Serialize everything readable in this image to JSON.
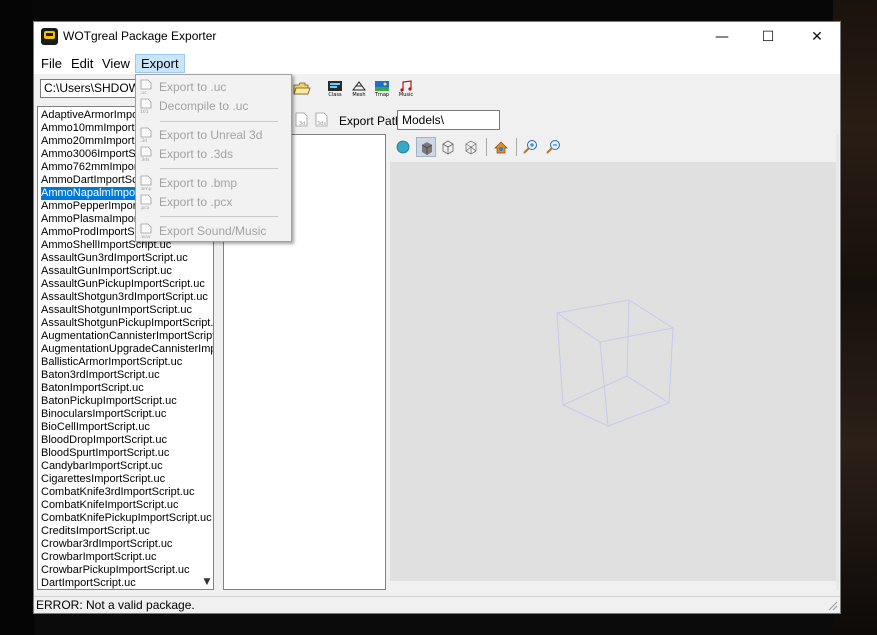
{
  "window": {
    "title": "WOTgreal Package Exporter",
    "controls": {
      "minimize": "—",
      "maximize": "☐",
      "close": "✕"
    }
  },
  "menubar": [
    "File",
    "Edit",
    "View",
    "Export"
  ],
  "toolbar": {
    "path_value": "C:\\Users\\SHDOW",
    "buttons": [
      {
        "label": "Class",
        "icon": "class-icon"
      },
      {
        "label": "Mesh",
        "icon": "mesh-icon"
      },
      {
        "label": "Tmap",
        "icon": "texture-map-icon"
      },
      {
        "label": "Music",
        "icon": "music-icon"
      }
    ],
    "export_buttons": [
      "3d",
      "3ds"
    ],
    "export_path_label": "Export Path:",
    "export_path_value": "Models\\"
  },
  "export_menu": {
    "items": [
      {
        "label": "Export to .uc",
        "icon_tag": ".uc"
      },
      {
        "label": "Decompile to .uc",
        "icon_tag": "101"
      },
      {
        "label": "Export to Unreal 3d",
        "icon_tag": ".3d"
      },
      {
        "label": "Export to .3ds",
        "icon_tag": ".3ds"
      },
      {
        "label": "Export to .bmp",
        "icon_tag": ".bmp"
      },
      {
        "label": "Export to .pcx",
        "icon_tag": ".pcx"
      },
      {
        "label": "Export Sound/Music",
        "icon_tag": ".wav"
      }
    ]
  },
  "script_list": {
    "selected_index": 6,
    "items": [
      "AdaptiveArmorImportScript.uc",
      "Ammo10mmImportScript.uc",
      "Ammo20mmImportScript.uc",
      "Ammo3006ImportScript.uc",
      "Ammo762mmImportScript.uc",
      "AmmoDartImportScript.uc",
      "AmmoNapalmImportScript.uc",
      "AmmoPepperImportScript.uc",
      "AmmoPlasmaImportScript.uc",
      "AmmoProdImportScript.uc",
      "AmmoShellImportScript.uc",
      "AssaultGun3rdImportScript.uc",
      "AssaultGunImportScript.uc",
      "AssaultGunPickupImportScript.uc",
      "AssaultShotgun3rdImportScript.uc",
      "AssaultShotgunImportScript.uc",
      "AssaultShotgunPickupImportScript.uc",
      "AugmentationCannisterImportScript.uc",
      "AugmentationUpgradeCannisterImportScript.uc",
      "BallisticArmorImportScript.uc",
      "Baton3rdImportScript.uc",
      "BatonImportScript.uc",
      "BatonPickupImportScript.uc",
      "BinocularsImportScript.uc",
      "BioCellImportScript.uc",
      "BloodDropImportScript.uc",
      "BloodSpurtImportScript.uc",
      "CandybarImportScript.uc",
      "CigarettesImportScript.uc",
      "CombatKnife3rdImportScript.uc",
      "CombatKnifeImportScript.uc",
      "CombatKnifePickupImportScript.uc",
      "CreditsImportScript.uc",
      "Crowbar3rdImportScript.uc",
      "CrowbarImportScript.uc",
      "CrowbarPickupImportScript.uc",
      "DartImportScript.uc"
    ]
  },
  "viewer_toolbar": {
    "buttons": [
      "sphere-icon",
      "solid-cube-icon",
      "wire-cube-icon",
      "wire-cube-3d-icon",
      "reset-view-icon",
      "zoom-in-icon",
      "zoom-out-icon"
    ]
  },
  "status": {
    "text": "ERROR: Not a valid package."
  }
}
